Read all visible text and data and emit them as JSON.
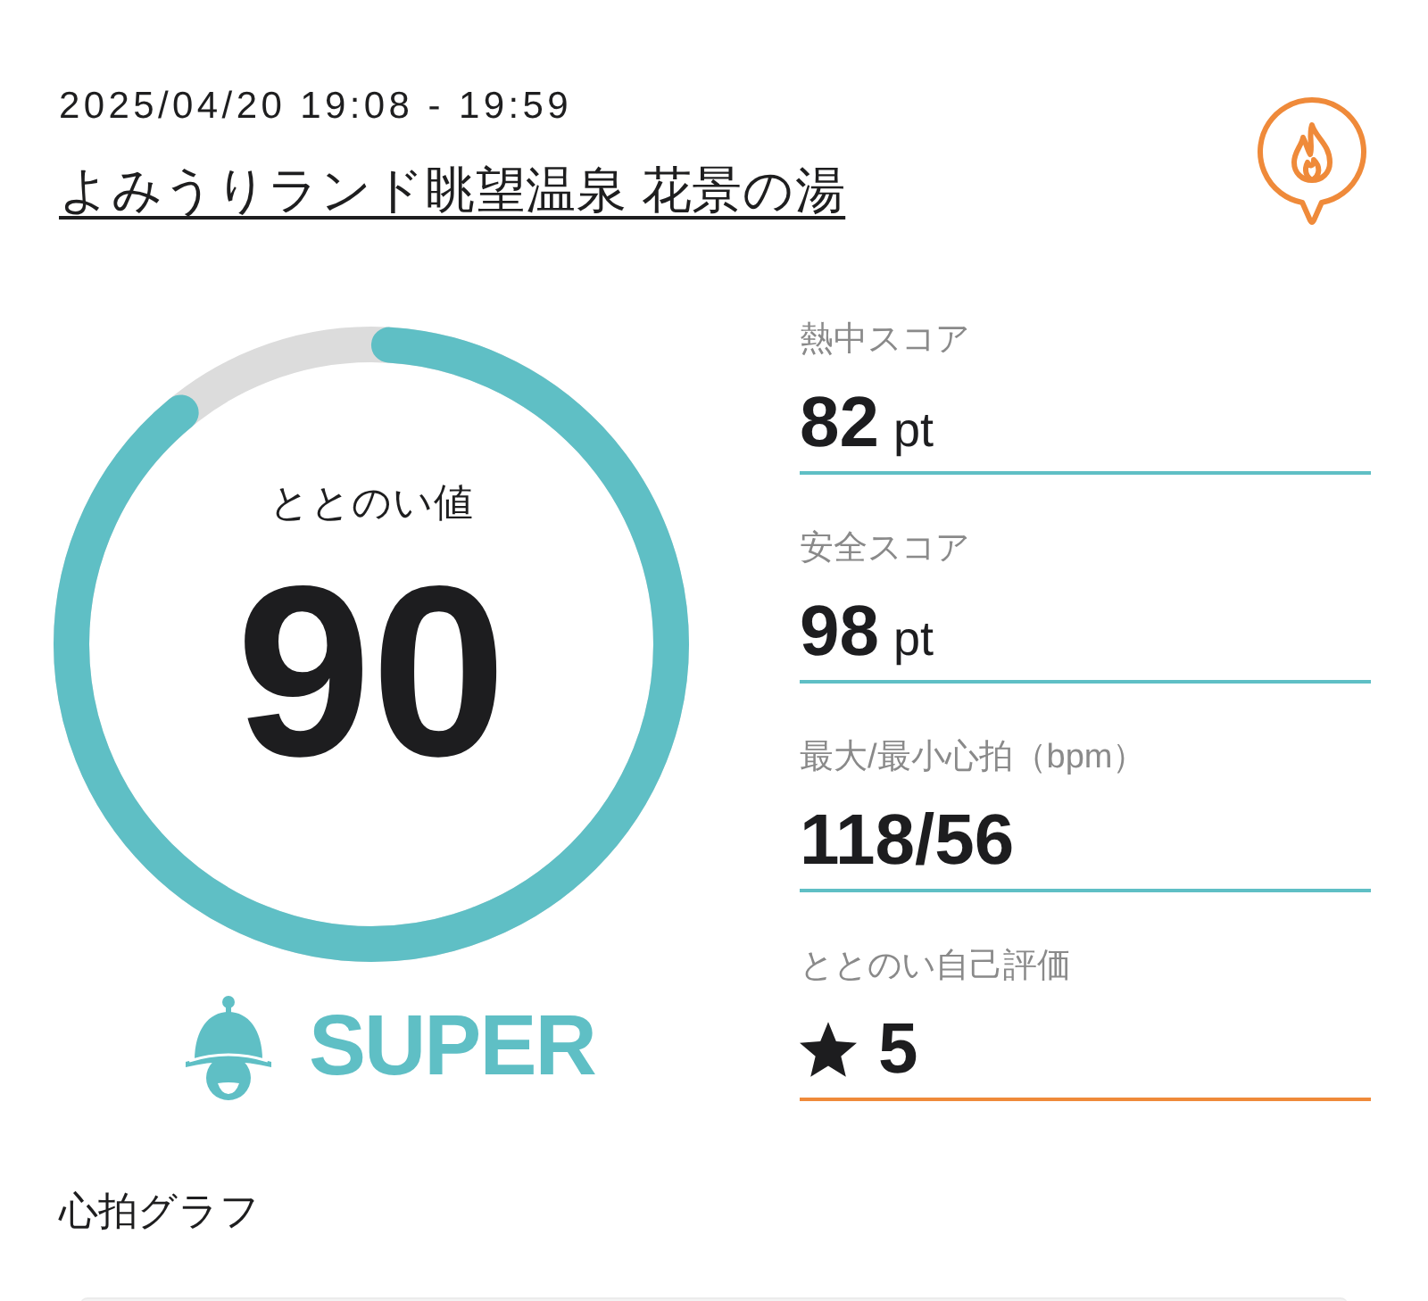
{
  "session": {
    "datetime": "2025/04/20 19:08 - 19:59",
    "facility": "よみうりランド眺望温泉 花景の湯"
  },
  "score_gauge": {
    "label": "ととのい値",
    "value": "90",
    "level": 0.9,
    "rank": "SUPER"
  },
  "metrics": [
    {
      "kind": "score",
      "label": "熱中スコア",
      "value": "82",
      "unit": "pt",
      "color": "#5fbfc5"
    },
    {
      "kind": "score",
      "label": "安全スコア",
      "value": "98",
      "unit": "pt",
      "color": "#5fbfc5"
    },
    {
      "kind": "score",
      "label": "最大/最小心拍（bpm）",
      "value": "118/56",
      "color": "#5fbfc5"
    },
    {
      "kind": "rating",
      "label": "ととのい自己評価",
      "value": "5",
      "color": "#ef8a3a"
    }
  ],
  "heart_rate_graph": {
    "title": "心拍グラフ"
  }
}
